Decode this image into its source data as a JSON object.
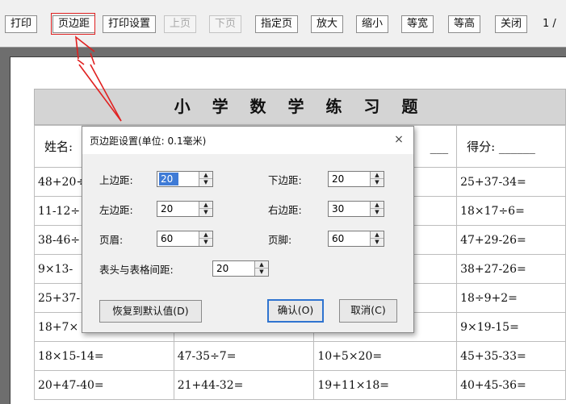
{
  "toolbar": {
    "buttons": [
      {
        "label": "打印",
        "enabled": true
      },
      {
        "label": "页边距",
        "enabled": true
      },
      {
        "label": "打印设置",
        "enabled": true
      },
      {
        "label": "上页",
        "enabled": false
      },
      {
        "label": "下页",
        "enabled": false
      },
      {
        "label": "指定页",
        "enabled": true
      },
      {
        "label": "放大",
        "enabled": true
      },
      {
        "label": "缩小",
        "enabled": true
      },
      {
        "label": "等宽",
        "enabled": true
      },
      {
        "label": "等高",
        "enabled": true
      },
      {
        "label": "关闭",
        "enabled": true
      }
    ],
    "page_indicator": "1 /"
  },
  "worksheet": {
    "title": "小 学 数 学 练 习 题",
    "info_row": [
      "姓名:",
      "",
      "___",
      "得分: ______"
    ],
    "rows": [
      [
        "48+20÷",
        "",
        "",
        "25+37-34="
      ],
      [
        "11-12÷",
        "",
        "",
        "18×17÷6="
      ],
      [
        "38-46÷",
        "",
        "",
        "47+29-26="
      ],
      [
        "9×13-",
        "",
        "",
        "38+27-26="
      ],
      [
        "25+37-",
        "",
        "",
        "18÷9+2="
      ],
      [
        "18+7×",
        "",
        "",
        "9×19-15="
      ],
      [
        "18×15-14=",
        "47-35÷7=",
        "10+5×20=",
        "45+35-33="
      ],
      [
        "20+47-40=",
        "21+44-32=",
        "19+11×18=",
        "40+45-36="
      ]
    ]
  },
  "dialog": {
    "title": "页边距设置(单位: 0.1毫米)",
    "close_glyph": "×",
    "fields": {
      "top_label": "上边距:",
      "top_value": "20",
      "bottom_label": "下边距:",
      "bottom_value": "20",
      "left_label": "左边距:",
      "left_value": "20",
      "right_label": "右边距:",
      "right_value": "30",
      "header_label": "页眉:",
      "header_value": "60",
      "footer_label": "页脚:",
      "footer_value": "60",
      "gap_label": "表头与表格间距:",
      "gap_value": "20"
    },
    "reset_button": "恢复到默认值(D)",
    "ok_button": "确认(O)",
    "cancel_button": "取消(C)"
  },
  "colors": {
    "annotation": "#e02020",
    "focus_blue": "#2f74d0"
  }
}
